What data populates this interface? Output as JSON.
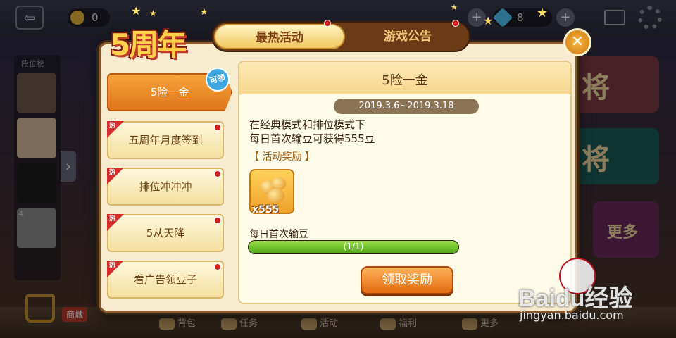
{
  "lobby": {
    "coins_value": "0",
    "diamond_value": "8",
    "rank_header": "段位榜",
    "rank_number": "4",
    "mode_card_text": "将",
    "more_card_text": "更多",
    "bottom_nav": [
      "背包",
      "任务",
      "活动",
      "福利",
      "更多"
    ],
    "shop_label": "商城"
  },
  "anniversary": {
    "badge_text": "5周年"
  },
  "tabs": {
    "active_label": "最热活动",
    "inactive_label": "游戏公告"
  },
  "activities": [
    {
      "label": "5险一金",
      "active": true,
      "hot": false
    },
    {
      "label": "五周年月度签到",
      "active": false,
      "hot": true
    },
    {
      "label": "排位冲冲冲",
      "active": false,
      "hot": true
    },
    {
      "label": "5从天降",
      "active": false,
      "hot": true
    },
    {
      "label": "看广告领豆子",
      "active": false,
      "hot": true
    }
  ],
  "hot_tag_text": "热",
  "claimable_badge": "可领",
  "detail": {
    "title": "5险一金",
    "date_range": "2019.3.6~2019.3.18",
    "desc_line1": "在经典模式和排位模式下",
    "desc_line2": "每日首次输豆可获得555豆",
    "reward_header": "【 活动奖励 】",
    "reward_qty": "x555",
    "task_label": "每日首次输豆",
    "progress_text": "(1/1)",
    "progress_fraction": 1.0,
    "claim_button": "领取奖励"
  },
  "watermark": {
    "brand": "Baidu经验",
    "url": "jingyan.baidu.com"
  },
  "colors": {
    "modal_bg": "#f7ecd0",
    "accent_orange": "#e0761a",
    "progress_green": "#4fa517"
  }
}
